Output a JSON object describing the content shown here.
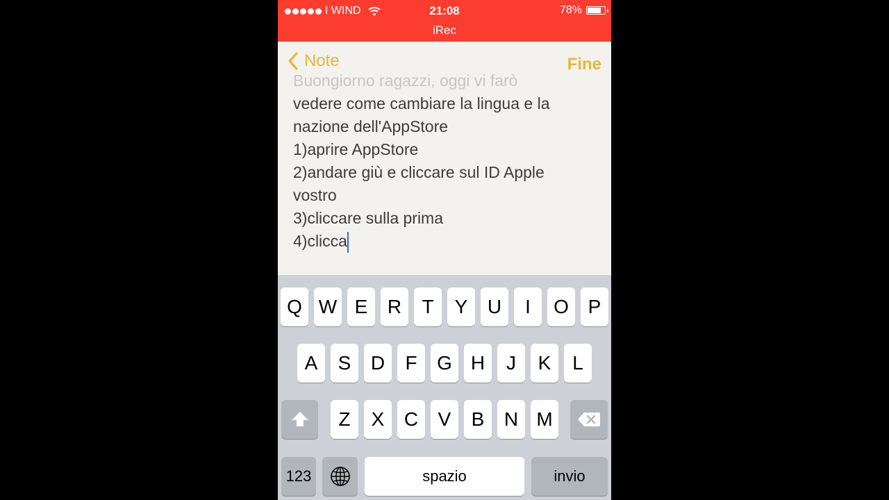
{
  "status_bar": {
    "carrier": "I WIND",
    "time": "21:08",
    "subtitle": "iRec",
    "battery": "78%",
    "battery_level": 0.78,
    "color": "#fd3c30"
  },
  "nav": {
    "back_label": "Note",
    "done_label": "Fine",
    "accent": "#e5b83a"
  },
  "note": {
    "lines": [
      "Buongiorno ragazzi, oggi vi farò",
      "vedere come cambiare la lingua e la",
      "nazione dell'AppStore",
      "1)aprire AppStore",
      "2)andare giù e cliccare sul ID Apple",
      "vostro",
      "3)cliccare sulla prima",
      "4)clicca"
    ]
  },
  "keyboard": {
    "row1": [
      "Q",
      "W",
      "E",
      "R",
      "T",
      "Y",
      "U",
      "I",
      "O",
      "P"
    ],
    "row2": [
      "A",
      "S",
      "D",
      "F",
      "G",
      "H",
      "J",
      "K",
      "L"
    ],
    "row3": [
      "Z",
      "X",
      "C",
      "V",
      "B",
      "N",
      "M"
    ],
    "numbers_key": "123",
    "space_key": "spazio",
    "return_key": "invio",
    "icons": {
      "shift": "shift-icon",
      "delete": "delete-icon",
      "globe": "globe-icon"
    }
  }
}
